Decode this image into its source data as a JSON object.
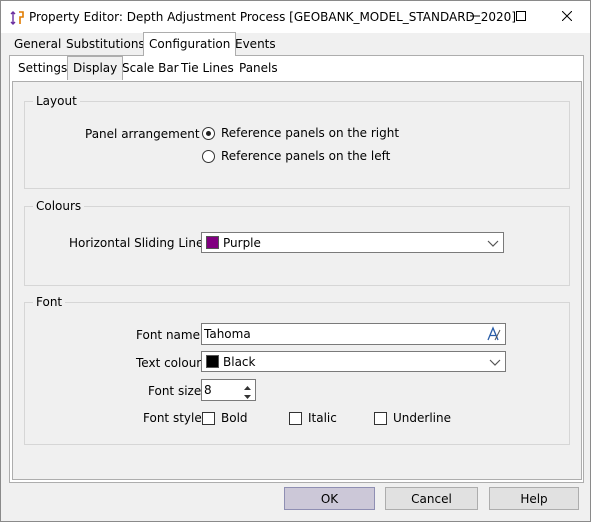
{
  "window": {
    "title": "Property Editor: Depth Adjustment Process [GEOBANK_MODEL_STANDARD_2020]",
    "icons": {
      "app": "depth-adjust-icon",
      "minimize": "minimize-icon",
      "maximize": "maximize-icon",
      "close": "close-icon"
    }
  },
  "tabs": [
    {
      "label": "General"
    },
    {
      "label": "Substitutions"
    },
    {
      "label": "Configuration",
      "active": true
    },
    {
      "label": "Events"
    }
  ],
  "subtabs": [
    {
      "label": "Settings"
    },
    {
      "label": "Display",
      "active": true
    },
    {
      "label": "Scale Bar"
    },
    {
      "label": "Tie Lines"
    },
    {
      "label": "Panels"
    }
  ],
  "layout": {
    "group_label": "Layout",
    "panel_arrangement_label": "Panel arrangement",
    "option_right": "Reference panels on the right",
    "option_left": "Reference panels on the left",
    "selected": "right"
  },
  "colours": {
    "group_label": "Colours",
    "sliding_lines_label": "Horizontal Sliding Lines",
    "sliding_lines_value": "Purple",
    "sliding_lines_color": "#800080"
  },
  "font": {
    "group_label": "Font",
    "name_label": "Font name",
    "name_value": "Tahoma",
    "text_colour_label": "Text colour",
    "text_colour_value": "Black",
    "text_colour_color": "#000000",
    "size_label": "Font size",
    "size_value": "8",
    "style_label": "Font style",
    "bold_label": "Bold",
    "italic_label": "Italic",
    "underline_label": "Underline",
    "bold": false,
    "italic": false,
    "underline": false,
    "font_picker_icon": "font-picker-icon"
  },
  "buttons": {
    "ok": "OK",
    "cancel": "Cancel",
    "help": "Help"
  }
}
